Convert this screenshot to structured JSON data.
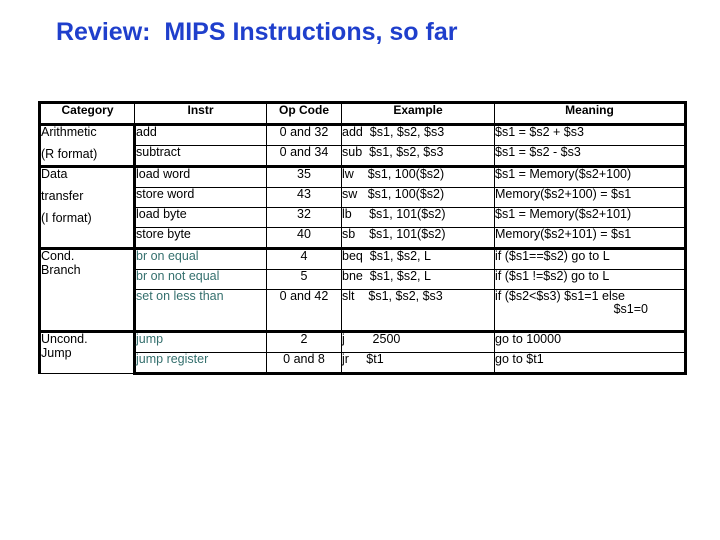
{
  "slide": {
    "title": "Review:  MIPS Instructions, so far",
    "title_color": "#1f3fcc",
    "accent_teal": "#35706e"
  },
  "table": {
    "columns": [
      "Category",
      "Instr",
      "Op Code",
      "Example",
      "Meaning"
    ],
    "groups": [
      {
        "category_lines": [
          "Arithmetic",
          "(R format)"
        ],
        "rows": [
          {
            "instr": "add",
            "instr_color": "black",
            "opcode": "0 and 32",
            "example": "add  $s1, $s2, $s3",
            "meaning": "$s1 = $s2 + $s3"
          },
          {
            "instr": "subtract",
            "instr_color": "black",
            "opcode": "0 and 34",
            "example": "sub  $s1, $s2, $s3",
            "meaning": "$s1 = $s2 - $s3"
          }
        ]
      },
      {
        "category_lines": [
          "Data",
          "transfer",
          "(I format)"
        ],
        "rows": [
          {
            "instr": "load word",
            "instr_color": "black",
            "opcode": "35",
            "example": "lw    $s1, 100($s2)",
            "meaning": "$s1 = Memory($s2+100)"
          },
          {
            "instr": "store word",
            "instr_color": "black",
            "opcode": "43",
            "example": "sw   $s1, 100($s2)",
            "meaning": "Memory($s2+100) = $s1"
          },
          {
            "instr": "load byte",
            "instr_color": "black",
            "opcode": "32",
            "example": "lb     $s1, 101($s2)",
            "meaning": "$s1 = Memory($s2+101)"
          },
          {
            "instr": "store byte",
            "instr_color": "black",
            "opcode": "40",
            "example": "sb    $s1, 101($s2)",
            "meaning": "Memory($s2+101) = $s1"
          }
        ]
      },
      {
        "category_lines": [
          "Cond.",
          "Branch"
        ],
        "rows": [
          {
            "instr": "br on equal",
            "instr_color": "teal",
            "opcode": "4",
            "example": "beq  $s1, $s2, L",
            "meaning": "if ($s1==$s2) go to L"
          },
          {
            "instr": "br on not equal",
            "instr_color": "teal",
            "opcode": "5",
            "example": "bne  $s1, $s2, L",
            "meaning": "if ($s1 !=$s2) go to L"
          },
          {
            "instr": "set on less than",
            "instr_color": "teal",
            "opcode": "0 and 42",
            "example": "slt    $s1, $s2, $s3",
            "meaning": "if ($s2<$s3) $s1=1 else",
            "meaning_line2": "$s1=0"
          }
        ]
      },
      {
        "category_lines": [
          "Uncond.",
          "Jump"
        ],
        "rows": [
          {
            "instr": "jump",
            "instr_color": "teal",
            "opcode": "2",
            "example": "j        2500",
            "meaning": "go to 10000"
          },
          {
            "instr": "jump register",
            "instr_color": "teal",
            "opcode": "0 and 8",
            "example": "jr     $t1",
            "meaning": "go to $t1"
          }
        ]
      }
    ]
  }
}
